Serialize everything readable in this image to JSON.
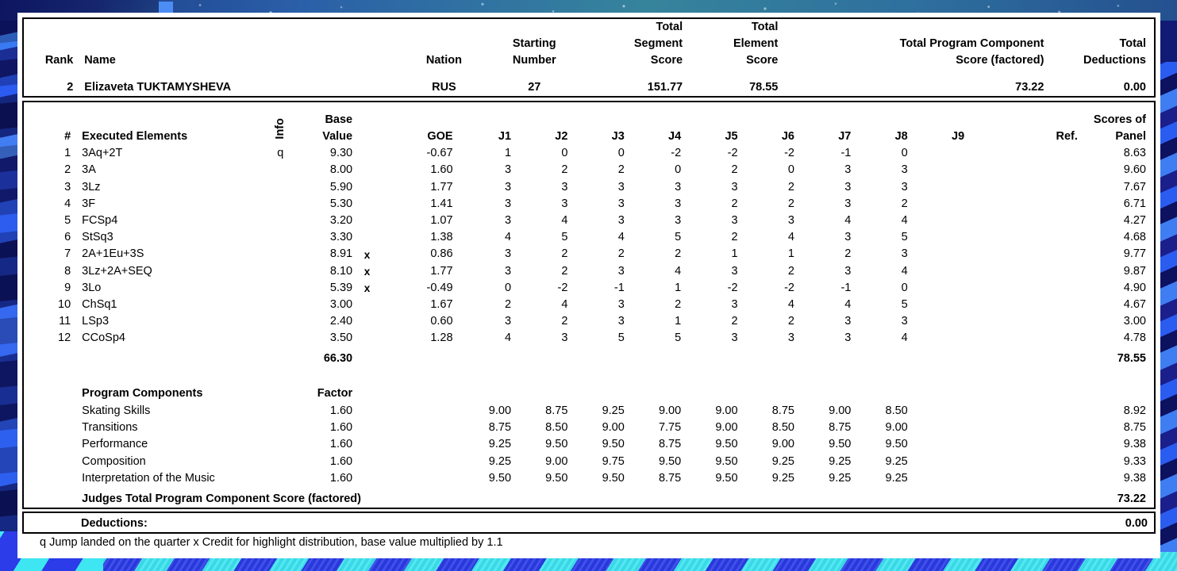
{
  "summary": {
    "headers": {
      "rank": "Rank",
      "name": "Name",
      "nation": "Nation",
      "starting_number": "Starting\nNumber",
      "total_segment_score": "Total\nSegment\nScore",
      "total_element_score": "Total\nElement\nScore",
      "total_program_component_score": "Total Program Component\nScore (factored)",
      "total_deductions": "Total\nDeductions"
    },
    "values": {
      "rank": "2",
      "name": "Elizaveta TUKTAMYSHEVA",
      "nation": "RUS",
      "starting_number": "27",
      "total_segment_score": "151.77",
      "total_element_score": "78.55",
      "total_program_component_score": "73.22",
      "total_deductions": "0.00"
    }
  },
  "elements": {
    "headers": {
      "num": "#",
      "executed_elements": "Executed Elements",
      "info": "Info",
      "base_value": "Base\nValue",
      "goe": "GOE",
      "j1": "J1",
      "j2": "J2",
      "j3": "J3",
      "j4": "J4",
      "j5": "J5",
      "j6": "J6",
      "j7": "J7",
      "j8": "J8",
      "j9": "J9",
      "ref": "Ref.",
      "scores_of_panel": "Scores of\nPanel"
    },
    "rows": [
      {
        "num": "1",
        "element": "3Aq+2T",
        "info": "q",
        "base_value": "9.30",
        "credit": "",
        "goe": "-0.67",
        "judges": [
          "1",
          "0",
          "0",
          "-2",
          "-2",
          "-2",
          "-1",
          "0",
          "",
          ""
        ],
        "ref": "",
        "score": "8.63"
      },
      {
        "num": "2",
        "element": "3A",
        "info": "",
        "base_value": "8.00",
        "credit": "",
        "goe": "1.60",
        "judges": [
          "3",
          "2",
          "2",
          "0",
          "2",
          "0",
          "3",
          "3",
          "",
          ""
        ],
        "ref": "",
        "score": "9.60"
      },
      {
        "num": "3",
        "element": "3Lz",
        "info": "",
        "base_value": "5.90",
        "credit": "",
        "goe": "1.77",
        "judges": [
          "3",
          "3",
          "3",
          "3",
          "3",
          "2",
          "3",
          "3",
          "",
          ""
        ],
        "ref": "",
        "score": "7.67"
      },
      {
        "num": "4",
        "element": "3F",
        "info": "",
        "base_value": "5.30",
        "credit": "",
        "goe": "1.41",
        "judges": [
          "3",
          "3",
          "3",
          "3",
          "2",
          "2",
          "3",
          "2",
          "",
          ""
        ],
        "ref": "",
        "score": "6.71"
      },
      {
        "num": "5",
        "element": "FCSp4",
        "info": "",
        "base_value": "3.20",
        "credit": "",
        "goe": "1.07",
        "judges": [
          "3",
          "4",
          "3",
          "3",
          "3",
          "3",
          "4",
          "4",
          "",
          ""
        ],
        "ref": "",
        "score": "4.27"
      },
      {
        "num": "6",
        "element": "StSq3",
        "info": "",
        "base_value": "3.30",
        "credit": "",
        "goe": "1.38",
        "judges": [
          "4",
          "5",
          "4",
          "5",
          "2",
          "4",
          "3",
          "5",
          "",
          ""
        ],
        "ref": "",
        "score": "4.68"
      },
      {
        "num": "7",
        "element": "2A+1Eu+3S",
        "info": "",
        "base_value": "8.91",
        "credit": "x",
        "goe": "0.86",
        "judges": [
          "3",
          "2",
          "2",
          "2",
          "1",
          "1",
          "2",
          "3",
          "",
          ""
        ],
        "ref": "",
        "score": "9.77"
      },
      {
        "num": "8",
        "element": "3Lz+2A+SEQ",
        "info": "",
        "base_value": "8.10",
        "credit": "x",
        "goe": "1.77",
        "judges": [
          "3",
          "2",
          "3",
          "4",
          "3",
          "2",
          "3",
          "4",
          "",
          ""
        ],
        "ref": "",
        "score": "9.87"
      },
      {
        "num": "9",
        "element": "3Lo",
        "info": "",
        "base_value": "5.39",
        "credit": "x",
        "goe": "-0.49",
        "judges": [
          "0",
          "-2",
          "-1",
          "1",
          "-2",
          "-2",
          "-1",
          "0",
          "",
          ""
        ],
        "ref": "",
        "score": "4.90"
      },
      {
        "num": "10",
        "element": "ChSq1",
        "info": "",
        "base_value": "3.00",
        "credit": "",
        "goe": "1.67",
        "judges": [
          "2",
          "4",
          "3",
          "2",
          "3",
          "4",
          "4",
          "5",
          "",
          ""
        ],
        "ref": "",
        "score": "4.67"
      },
      {
        "num": "11",
        "element": "LSp3",
        "info": "",
        "base_value": "2.40",
        "credit": "",
        "goe": "0.60",
        "judges": [
          "3",
          "2",
          "3",
          "1",
          "2",
          "2",
          "3",
          "3",
          "",
          ""
        ],
        "ref": "",
        "score": "3.00"
      },
      {
        "num": "12",
        "element": "CCoSp4",
        "info": "",
        "base_value": "3.50",
        "credit": "",
        "goe": "1.28",
        "judges": [
          "4",
          "3",
          "5",
          "5",
          "3",
          "3",
          "3",
          "4",
          "",
          ""
        ],
        "ref": "",
        "score": "4.78"
      }
    ],
    "totals": {
      "base_value_total": "66.30",
      "element_score_total": "78.55"
    }
  },
  "program_components": {
    "title": "Program Components",
    "factor_label": "Factor",
    "rows": [
      {
        "label": "Skating Skills",
        "factor": "1.60",
        "judges": [
          "9.00",
          "8.75",
          "9.25",
          "9.00",
          "9.00",
          "8.75",
          "9.00",
          "8.50",
          "",
          ""
        ],
        "score": "8.92"
      },
      {
        "label": "Transitions",
        "factor": "1.60",
        "judges": [
          "8.75",
          "8.50",
          "9.00",
          "7.75",
          "9.00",
          "8.50",
          "8.75",
          "9.00",
          "",
          ""
        ],
        "score": "8.75"
      },
      {
        "label": "Performance",
        "factor": "1.60",
        "judges": [
          "9.25",
          "9.50",
          "9.50",
          "8.75",
          "9.50",
          "9.00",
          "9.50",
          "9.50",
          "",
          ""
        ],
        "score": "9.38"
      },
      {
        "label": "Composition",
        "factor": "1.60",
        "judges": [
          "9.25",
          "9.00",
          "9.75",
          "9.50",
          "9.50",
          "9.25",
          "9.25",
          "9.25",
          "",
          ""
        ],
        "score": "9.33"
      },
      {
        "label": "Interpretation of the Music",
        "factor": "1.60",
        "judges": [
          "9.50",
          "9.50",
          "9.50",
          "8.75",
          "9.50",
          "9.25",
          "9.25",
          "9.25",
          "",
          ""
        ],
        "score": "9.38"
      }
    ],
    "total_label": "Judges Total Program Component Score (factored)",
    "total_value": "73.22"
  },
  "deductions": {
    "label": "Deductions:",
    "value": "0.00"
  },
  "legend": "q Jump landed on the quarter   x Credit for highlight distribution, base value multiplied by 1.1",
  "colors": {
    "text": "#000000",
    "sheet": "#ffffff",
    "border": "#000000",
    "bg_deep_blue": "#131c66",
    "bg_bright_blue": "#2b5cf0",
    "bg_cyan": "#3ee6f2"
  }
}
